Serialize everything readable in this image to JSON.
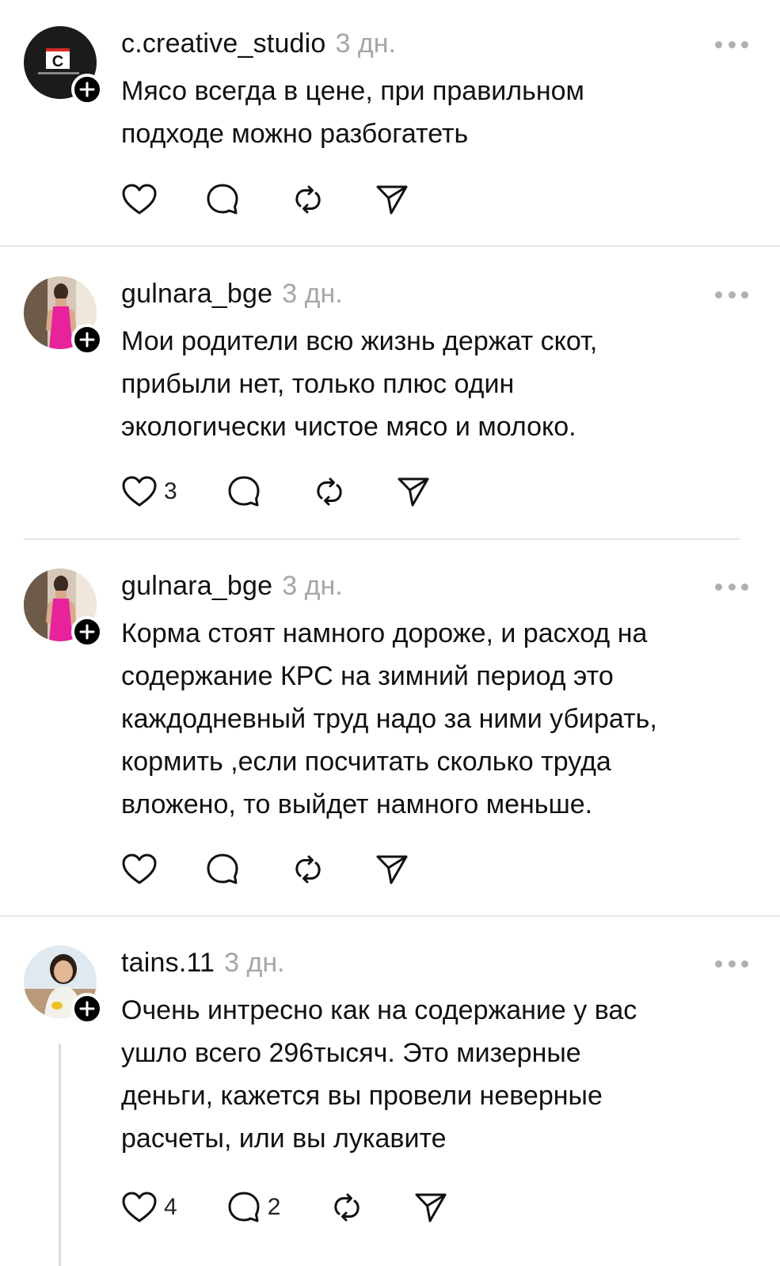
{
  "posts": [
    {
      "username": "c.creative_studio",
      "time": "3 дн.",
      "text": "Мясо всегда в цене, при правильном\nподходе можно разбогатеть",
      "likes": "",
      "replies": "",
      "avatar": {
        "kind": "logo",
        "letter": "C",
        "caption": "CREATIVE STU"
      }
    },
    {
      "username": "gulnara_bge",
      "time": "3 дн.",
      "text": "Мои родители всю жизнь держат скот,\nприбыли нет, только плюс один\nэкологически чистое мясо и молоко.",
      "likes": "3",
      "replies": "",
      "avatar": {
        "kind": "photo-pink-dress"
      }
    },
    {
      "username": "gulnara_bge",
      "time": "3 дн.",
      "text": "Корма стоят намного дороже, и расход на\nсодержание КРС на зимний период это\nкаждодневный труд надо за ними убирать,\nкормить ,если посчитать сколько труда\nвложено, то выйдет намного меньше.",
      "likes": "",
      "replies": "",
      "avatar": {
        "kind": "photo-pink-dress"
      }
    },
    {
      "username": "tains.11",
      "time": "3 дн.",
      "text": "Очень интресно как на содержание у вас\nушло всего 296тысяч. Это мизерные\nденьги, кажется вы провели неверные\nрасчеты, или вы лукавите",
      "likes": "4",
      "replies": "2",
      "avatar": {
        "kind": "photo-woman"
      }
    }
  ],
  "icons": {
    "like": "heart-icon",
    "reply": "comment-bubble-icon",
    "repost": "repost-icon",
    "share": "send-icon",
    "more": "more-dots-icon",
    "follow": "plus-icon"
  },
  "colors": {
    "text": "#111111",
    "muted": "#a6a6a6",
    "divider": "#e6e6e6",
    "accent_pink": "#e8229a"
  }
}
